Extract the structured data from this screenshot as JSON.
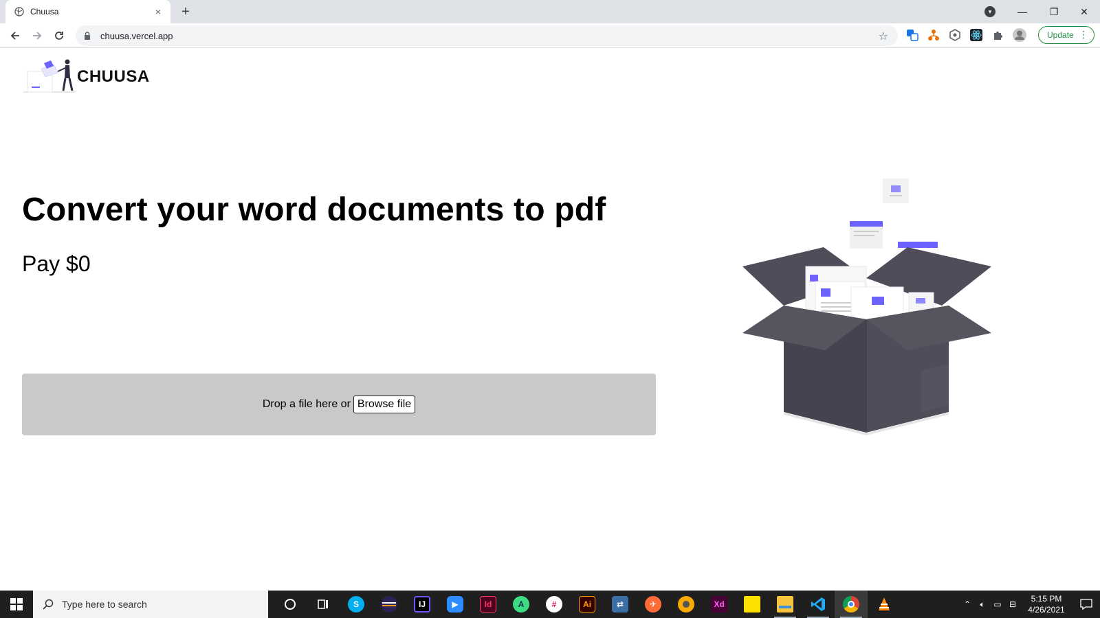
{
  "browser": {
    "tab_title": "Chuusa",
    "tab_close": "×",
    "new_tab": "+",
    "url": "chuusa.vercel.app",
    "update_label": "Update",
    "window_controls": {
      "minimize": "—",
      "restore": "❐",
      "close": "✕"
    }
  },
  "page": {
    "brand": "CHUUSA",
    "headline": "Convert your word documents to pdf",
    "price": "Pay $0",
    "dropzone": {
      "text": "Drop a file here or",
      "browse_label": "Browse file"
    },
    "accent_color": "#6c63ff",
    "box_color": "#4f4d5a"
  },
  "taskbar": {
    "search_placeholder": "Type here to search",
    "time": "5:15 PM",
    "date": "4/26/2021",
    "apps": [
      {
        "name": "cortana",
        "label": ""
      },
      {
        "name": "task-view",
        "label": ""
      },
      {
        "name": "skype",
        "label": "S"
      },
      {
        "name": "eclipse",
        "label": ""
      },
      {
        "name": "intellij",
        "label": "IJ"
      },
      {
        "name": "zoom",
        "label": ""
      },
      {
        "name": "indesign",
        "label": "Id"
      },
      {
        "name": "android-studio",
        "label": ""
      },
      {
        "name": "slack",
        "label": ""
      },
      {
        "name": "illustrator",
        "label": "Ai"
      },
      {
        "name": "network-app",
        "label": ""
      },
      {
        "name": "postman",
        "label": ""
      },
      {
        "name": "chrome-canary",
        "label": ""
      },
      {
        "name": "xd",
        "label": "Xd"
      },
      {
        "name": "sticky-notes",
        "label": ""
      },
      {
        "name": "file-explorer",
        "label": ""
      },
      {
        "name": "vscode",
        "label": ""
      },
      {
        "name": "chrome",
        "label": ""
      },
      {
        "name": "vlc",
        "label": ""
      }
    ]
  }
}
